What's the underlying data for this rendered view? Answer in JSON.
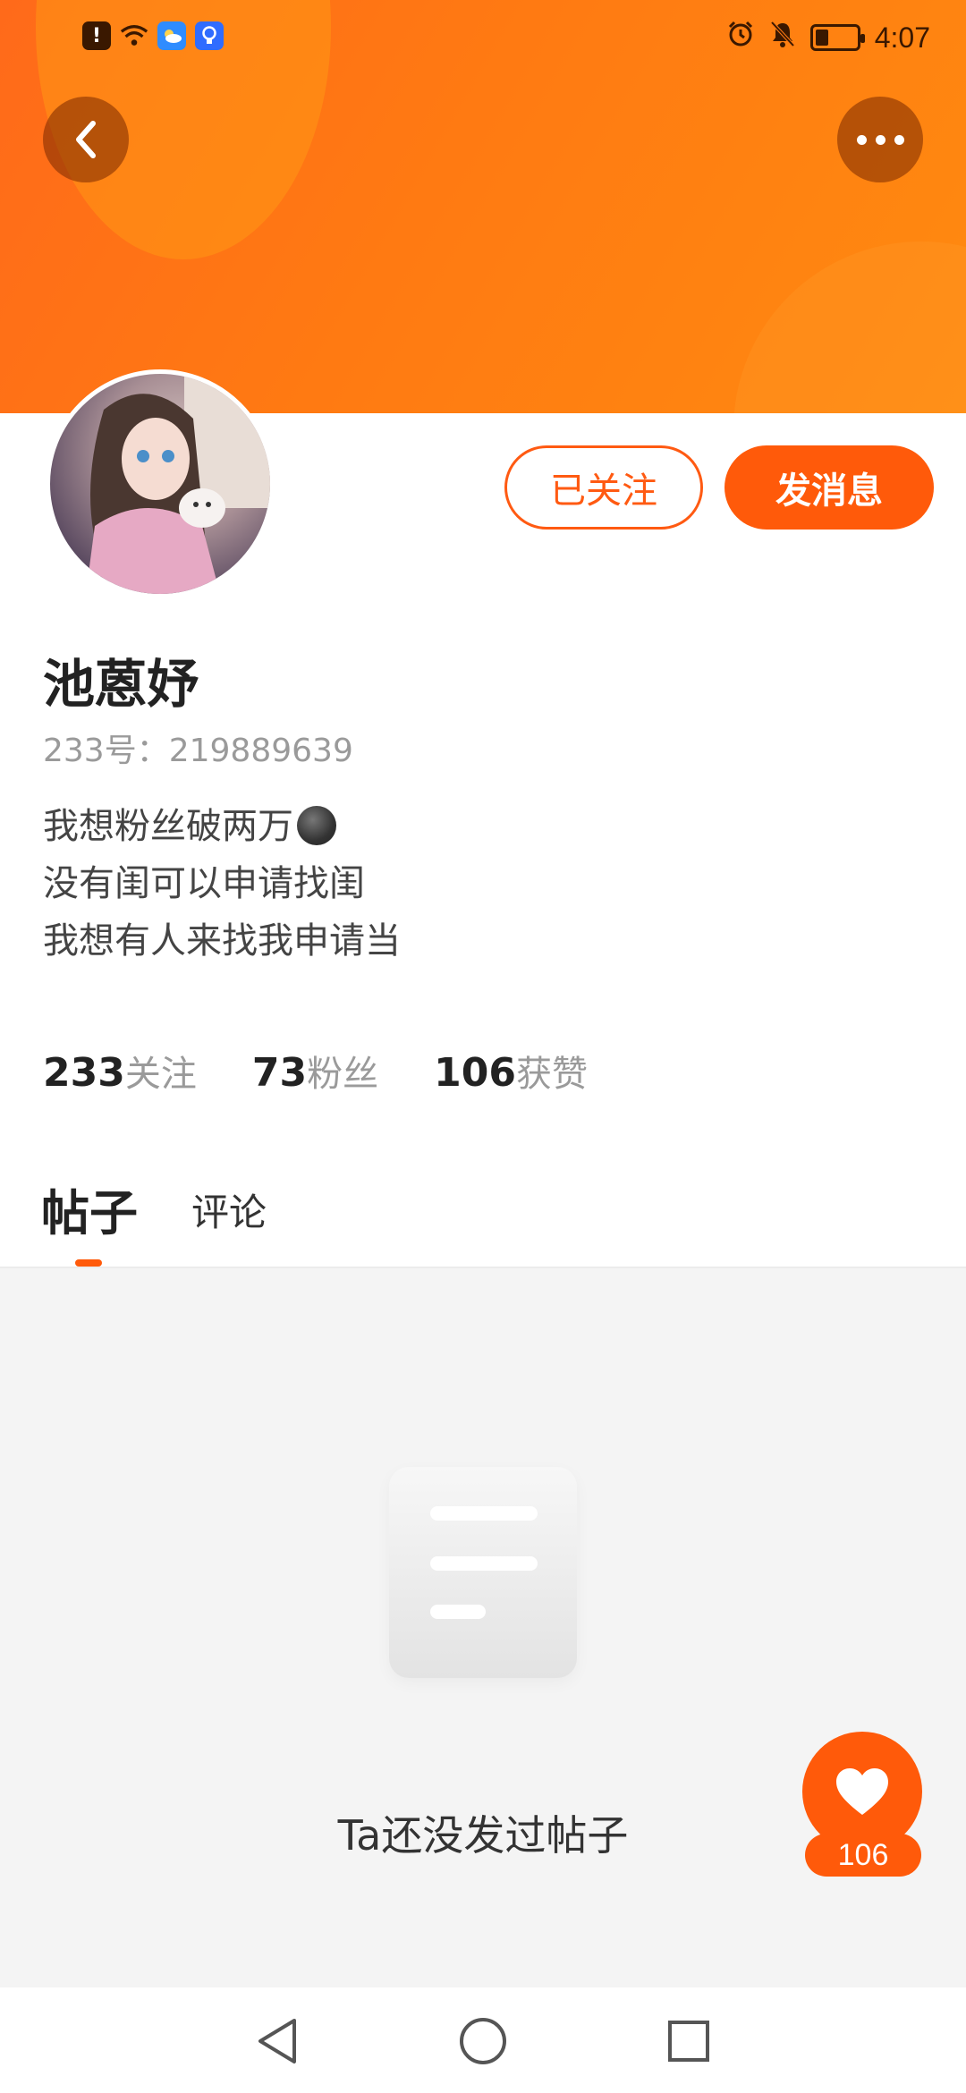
{
  "status_bar": {
    "time": "4:07"
  },
  "header": {
    "back_icon": "chevron-left-icon",
    "more_icon": "more-dots-icon"
  },
  "profile": {
    "name": "池蒽妤",
    "id_text": "233号：219889639",
    "bio": [
      "我想粉丝破两万",
      "没有闺可以申请找闺",
      "我想有人来找我申请当"
    ],
    "followed_label": "已关注",
    "message_label": "发消息"
  },
  "stats": [
    {
      "num": "233",
      "label": "关注"
    },
    {
      "num": "73",
      "label": "粉丝"
    },
    {
      "num": "106",
      "label": "获赞"
    }
  ],
  "tabs": {
    "posts": "帖子",
    "comments": "评论"
  },
  "empty_state": {
    "text": "Ta还没发过帖子"
  },
  "like_button": {
    "count": "106",
    "icon": "heart-icon"
  },
  "colors": {
    "accent": "#ff5a0a",
    "banner": "#ff7a12"
  }
}
